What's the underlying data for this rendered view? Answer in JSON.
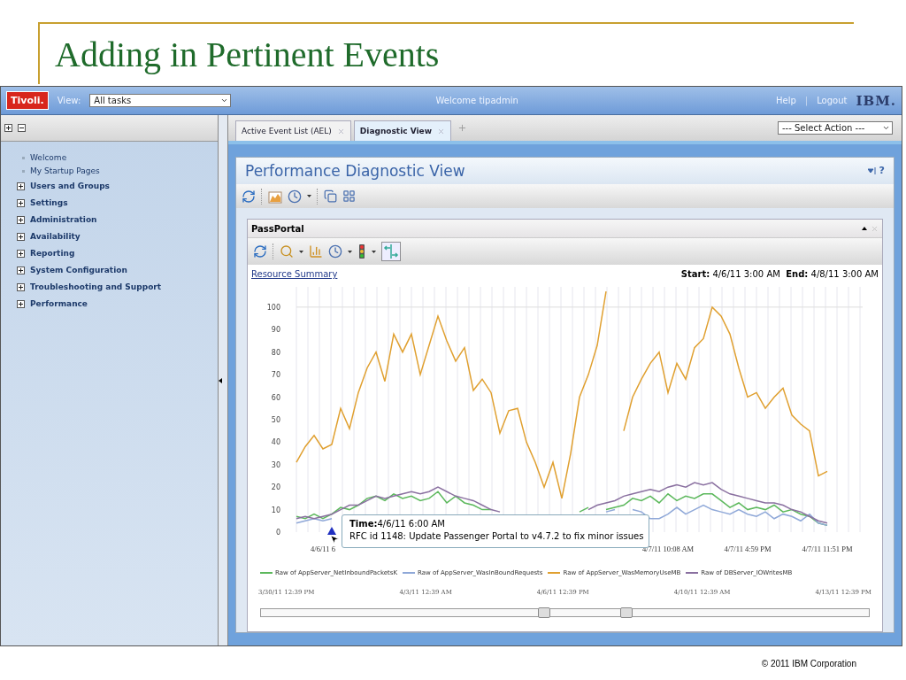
{
  "slide": {
    "title": "Adding in Pertinent Events",
    "footer": "© 2011 IBM Corporation"
  },
  "topbar": {
    "logo": "Tivoli.",
    "view_label": "View:",
    "view_value": "All tasks",
    "welcome": "Welcome tipadmin",
    "links": [
      "Help",
      "Logout"
    ],
    "separator": "|",
    "brand": "IBM."
  },
  "sidebar": {
    "items": [
      {
        "label": "Welcome",
        "kind": "link"
      },
      {
        "label": "My Startup Pages",
        "kind": "link"
      },
      {
        "label": "Users and Groups",
        "kind": "folder",
        "expanded": false
      },
      {
        "label": "Settings",
        "kind": "folder",
        "expanded": false
      },
      {
        "label": "Administration",
        "kind": "folder",
        "expanded": false
      },
      {
        "label": "Availability",
        "kind": "folder",
        "expanded": false
      },
      {
        "label": "Reporting",
        "kind": "folder",
        "expanded": false
      },
      {
        "label": "System Configuration",
        "kind": "folder",
        "expanded": false
      },
      {
        "label": "Troubleshooting and Support",
        "kind": "folder",
        "expanded": false
      },
      {
        "label": "Performance",
        "kind": "folder",
        "expanded": false
      }
    ]
  },
  "tabs": [
    {
      "label": "Active Event List (AEL)",
      "selected": false
    },
    {
      "label": "Diagnostic View",
      "selected": true
    }
  ],
  "action_select": "--- Select Action ---",
  "panel": {
    "title": "Performance Diagnostic View",
    "help": "?"
  },
  "portlet": {
    "title": "PassPortal",
    "link": "Resource Summary",
    "start_label": "Start:",
    "start": "4/6/11 3:00 AM",
    "end_label": "End:",
    "end": "4/8/11 3:00 AM",
    "chart_data": {
      "type": "line",
      "grid": true,
      "ref_lines": [
        {
          "axis": "y",
          "value": 100
        }
      ],
      "ylim": [
        0,
        109
      ],
      "yticks": [
        0,
        10,
        20,
        30,
        40,
        50,
        60,
        70,
        80,
        90,
        100
      ],
      "categories": [
        null,
        null,
        null,
        "4/6/11 6",
        null,
        null,
        null,
        null,
        null,
        null,
        null,
        null,
        null,
        null,
        null,
        null,
        null,
        null,
        null,
        null,
        null,
        null,
        null,
        null,
        null,
        null,
        null,
        null,
        null,
        null,
        null,
        null,
        null,
        null,
        null,
        null,
        null,
        null,
        null,
        null,
        null,
        null,
        "4/7/11 10:08 AM",
        null,
        null,
        null,
        null,
        null,
        null,
        null,
        null,
        "4/7/11 4:59 PM",
        null,
        null,
        null,
        null,
        null,
        null,
        null,
        null,
        "4/7/11 11:51 PM"
      ],
      "series": [
        {
          "name": "Raw of AppServer_NetInboundPacketsK",
          "color": "#5cb85c",
          "values": [
            7,
            6,
            8,
            6,
            8,
            11,
            10,
            12,
            15,
            16,
            14,
            17,
            15,
            16,
            14,
            15,
            18,
            13,
            16,
            13,
            12,
            10,
            10,
            null,
            null,
            null,
            null,
            null,
            null,
            null,
            null,
            null,
            9,
            11,
            null,
            10,
            11,
            12,
            15,
            14,
            16,
            13,
            17,
            14,
            16,
            15,
            17,
            17,
            14,
            11,
            13,
            10,
            11,
            10,
            12,
            9,
            10,
            8,
            7,
            4,
            3
          ]
        },
        {
          "name": "Raw of AppServer_WasInBoundRequests",
          "color": "#8fa8d8",
          "values": [
            4,
            5,
            6,
            5,
            6,
            null,
            null,
            null,
            null,
            null,
            null,
            null,
            null,
            null,
            null,
            null,
            null,
            null,
            null,
            null,
            null,
            null,
            null,
            null,
            null,
            null,
            null,
            null,
            null,
            null,
            null,
            null,
            null,
            null,
            null,
            9,
            10,
            null,
            10,
            9,
            6,
            6,
            8,
            11,
            8,
            10,
            12,
            10,
            9,
            8,
            10,
            8,
            7,
            9,
            6,
            8,
            7,
            5,
            8,
            4,
            3
          ]
        },
        {
          "name": "Raw of AppServer_WasMemoryUseMB",
          "color": "#e0a030",
          "values": [
            31,
            38,
            43,
            37,
            39,
            55,
            46,
            62,
            73,
            80,
            67,
            88,
            80,
            88,
            70,
            83,
            96,
            85,
            76,
            82,
            63,
            68,
            62,
            44,
            54,
            55,
            40,
            31,
            20,
            31,
            15,
            35,
            60,
            70,
            83,
            107,
            null,
            45,
            60,
            68,
            75,
            80,
            62,
            75,
            68,
            82,
            86,
            100,
            96,
            88,
            73,
            60,
            62,
            55,
            60,
            64,
            52,
            48,
            45,
            25,
            27
          ]
        },
        {
          "name": "Raw of DBServer_IOWritesMB",
          "color": "#8a70a0",
          "values": [
            6,
            7,
            6,
            7,
            8,
            10,
            12,
            12,
            14,
            16,
            15,
            16,
            17,
            18,
            17,
            18,
            20,
            18,
            16,
            15,
            14,
            12,
            10,
            9,
            null,
            null,
            null,
            null,
            null,
            null,
            null,
            null,
            null,
            10,
            12,
            13,
            14,
            16,
            17,
            18,
            19,
            18,
            20,
            21,
            20,
            22,
            21,
            22,
            19,
            17,
            16,
            15,
            14,
            13,
            13,
            12,
            10,
            9,
            7,
            5,
            4
          ]
        }
      ]
    },
    "tooltip": {
      "time_label": "Time:",
      "time": "4/6/11 6:00 AM",
      "text": "RFC id 1148: Update Passenger Portal to v4.7.2 to fix minor issues"
    },
    "timeline": {
      "labels": [
        "3/30/11 12:39 PM",
        "4/3/11 12:39 AM",
        "4/6/11 12:39 PM",
        "4/10/11 12:39 AM",
        "4/13/11 12:39 PM"
      ],
      "thumbs": [
        {
          "level": 0.465
        },
        {
          "level": 0.6
        }
      ]
    }
  }
}
